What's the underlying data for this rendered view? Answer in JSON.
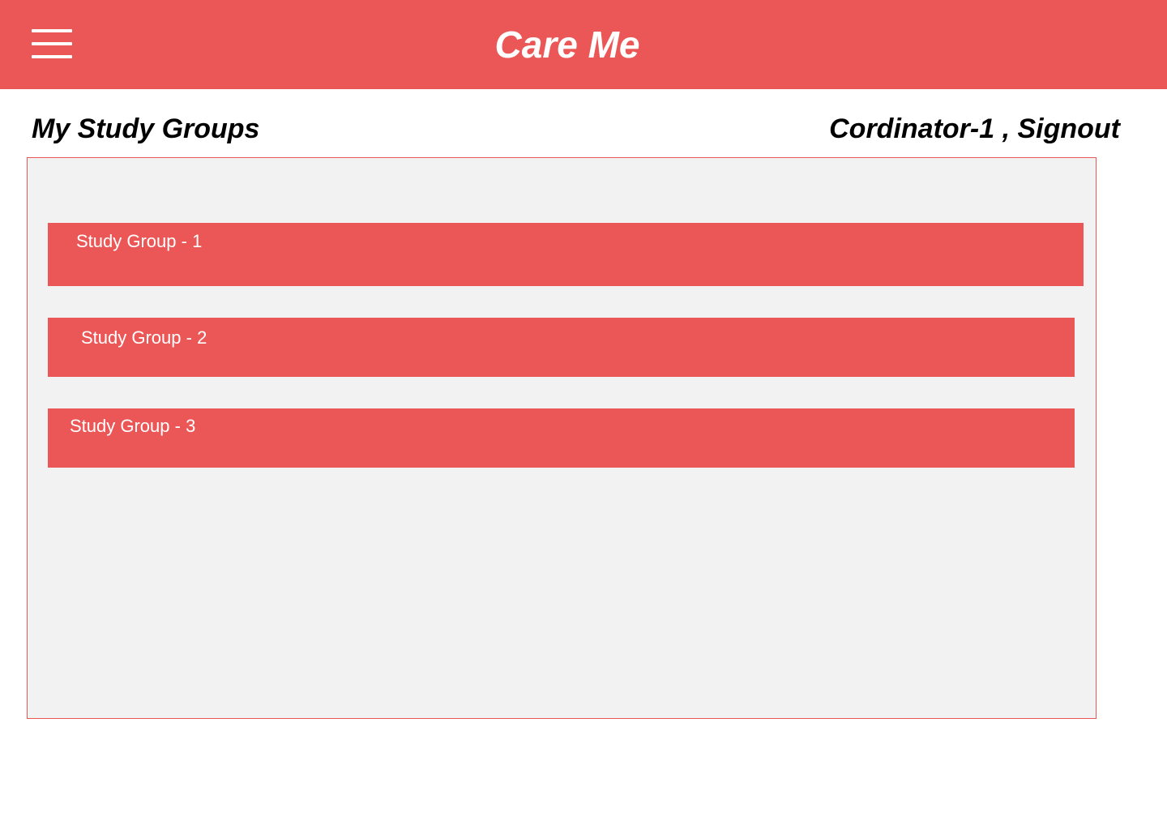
{
  "header": {
    "app_title": "Care Me",
    "menu_icon": "hamburger-menu-icon",
    "background_color": "#EB5757"
  },
  "page": {
    "title": "My Study Groups"
  },
  "user": {
    "name": "Cordinator-1",
    "separator": " , ",
    "signout_label": "Signout"
  },
  "study_groups": [
    {
      "label": "Study Group - 1"
    },
    {
      "label": "Study Group - 2"
    },
    {
      "label": "Study Group - 3"
    }
  ],
  "colors": {
    "accent": "#EB5757",
    "panel_background": "#F2F2F2",
    "text_primary": "#000000",
    "text_on_accent": "#FFFFFF"
  }
}
